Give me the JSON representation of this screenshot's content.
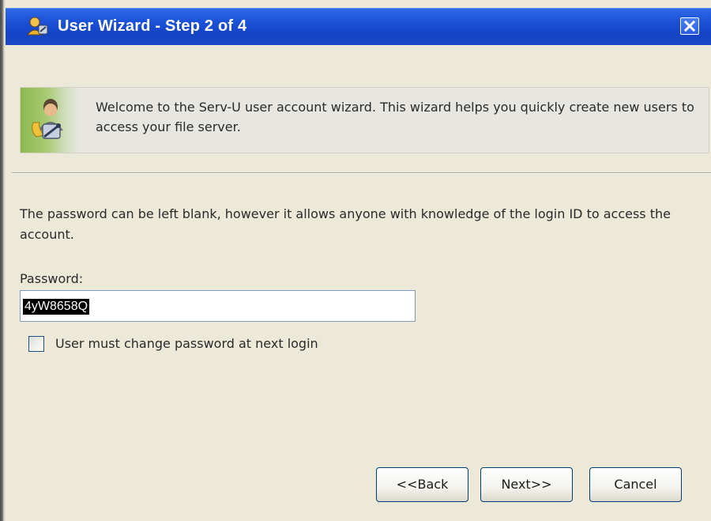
{
  "window": {
    "title": "User Wizard - Step 2 of 4"
  },
  "banner": {
    "text": "Welcome to the Serv-U user account wizard. This wizard helps you quickly create new users to access your file server."
  },
  "form": {
    "description": "The password can be left blank, however it allows anyone with knowledge of the login ID to access the account.",
    "password_label": "Password:",
    "password_value": "4yW8658Q",
    "change_password_label": "User must change password at next login",
    "change_password_checked": false
  },
  "buttons": {
    "back": "<<Back",
    "next": "Next>>",
    "cancel": "Cancel"
  },
  "icons": {
    "title": "wizard-user-icon",
    "close": "close-icon",
    "banner": "user-wizard-icon"
  },
  "colors": {
    "titlebar": "#1c52d8",
    "window_bg": "#ece9d8",
    "banner_accent": "#8cb850",
    "selection": "#000000"
  }
}
